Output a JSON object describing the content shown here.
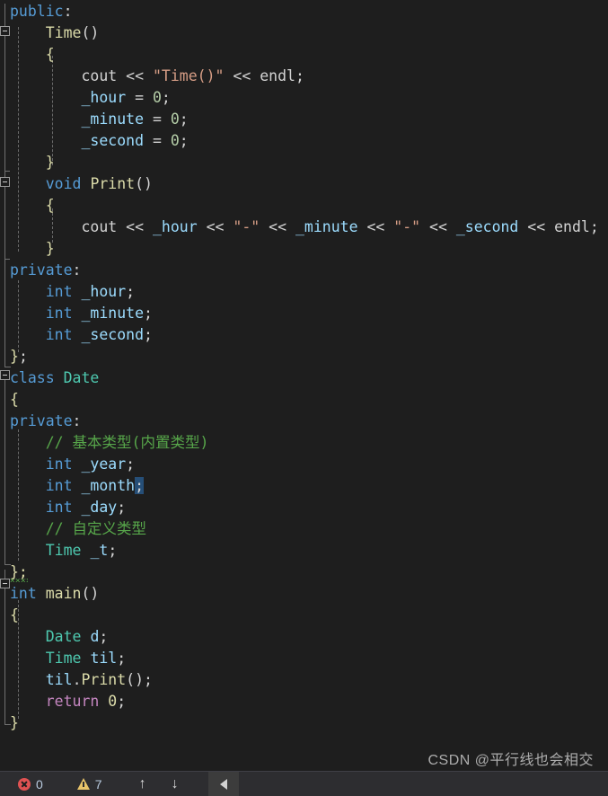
{
  "window": {
    "kind": "code-editor",
    "theme": "dark",
    "background": "#1e1e1e",
    "language": "C++"
  },
  "editor": {
    "lines": [
      {
        "n": 1,
        "indent": 0,
        "text": "public:"
      },
      {
        "n": 2,
        "indent": 1,
        "text": "Time()"
      },
      {
        "n": 3,
        "indent": 1,
        "text": "{"
      },
      {
        "n": 4,
        "indent": 2,
        "text": "cout << \"Time()\" << endl;"
      },
      {
        "n": 5,
        "indent": 2,
        "text": "_hour = 0;"
      },
      {
        "n": 6,
        "indent": 2,
        "text": "_minute = 0;"
      },
      {
        "n": 7,
        "indent": 2,
        "text": "_second = 0;"
      },
      {
        "n": 8,
        "indent": 1,
        "text": "}"
      },
      {
        "n": 9,
        "indent": 1,
        "text": "void Print()"
      },
      {
        "n": 10,
        "indent": 1,
        "text": "{"
      },
      {
        "n": 11,
        "indent": 2,
        "text": "cout << _hour << \"-\" << _minute << \"-\" << _second << endl;"
      },
      {
        "n": 12,
        "indent": 1,
        "text": "}"
      },
      {
        "n": 13,
        "indent": 0,
        "text": "private:"
      },
      {
        "n": 14,
        "indent": 1,
        "text": "int _hour;"
      },
      {
        "n": 15,
        "indent": 1,
        "text": "int _minute;"
      },
      {
        "n": 16,
        "indent": 1,
        "text": "int _second;"
      },
      {
        "n": 17,
        "indent": 0,
        "text": "};"
      },
      {
        "n": 18,
        "indent": 0,
        "text": "class Date"
      },
      {
        "n": 19,
        "indent": 0,
        "text": "{"
      },
      {
        "n": 20,
        "indent": 0,
        "text": "private:"
      },
      {
        "n": 21,
        "indent": 1,
        "text": "// 基本类型(内置类型)"
      },
      {
        "n": 22,
        "indent": 1,
        "text": "int _year;"
      },
      {
        "n": 23,
        "indent": 1,
        "text": "int _month;"
      },
      {
        "n": 24,
        "indent": 1,
        "text": "int _day;"
      },
      {
        "n": 25,
        "indent": 1,
        "text": "// 自定义类型"
      },
      {
        "n": 26,
        "indent": 1,
        "text": "Time _t;"
      },
      {
        "n": 27,
        "indent": 0,
        "text": "};"
      },
      {
        "n": 28,
        "indent": 0,
        "text": "int main()"
      },
      {
        "n": 29,
        "indent": 0,
        "text": "{"
      },
      {
        "n": 30,
        "indent": 1,
        "text": "Date d;"
      },
      {
        "n": 31,
        "indent": 1,
        "text": "Time til;"
      },
      {
        "n": 32,
        "indent": 1,
        "text": "til.Print();"
      },
      {
        "n": 33,
        "indent": 1,
        "text": "return 0;"
      },
      {
        "n": 34,
        "indent": 0,
        "text": "}"
      }
    ],
    "tokens": {
      "L1": [
        [
          "public",
          "t-kw"
        ],
        [
          ":",
          "t-punct"
        ]
      ],
      "L2": [
        [
          "    ",
          "t-plain"
        ],
        [
          "Time",
          "t-fn"
        ],
        [
          "()",
          "t-punct"
        ]
      ],
      "L3": [
        [
          "    ",
          "t-plain"
        ],
        [
          "{",
          "t-brace"
        ]
      ],
      "L4": [
        [
          "        ",
          "t-plain"
        ],
        [
          "cout",
          "t-cout"
        ],
        [
          " << ",
          "t-op"
        ],
        [
          "\"Time()\"",
          "t-str"
        ],
        [
          " << ",
          "t-op"
        ],
        [
          "endl",
          "t-cout"
        ],
        [
          ";",
          "t-punct"
        ]
      ],
      "L5": [
        [
          "        ",
          "t-plain"
        ],
        [
          "_hour",
          "t-var"
        ],
        [
          " = ",
          "t-op"
        ],
        [
          "0",
          "t-num"
        ],
        [
          ";",
          "t-punct"
        ]
      ],
      "L6": [
        [
          "        ",
          "t-plain"
        ],
        [
          "_minute",
          "t-var"
        ],
        [
          " = ",
          "t-op"
        ],
        [
          "0",
          "t-num"
        ],
        [
          ";",
          "t-punct"
        ]
      ],
      "L7": [
        [
          "        ",
          "t-plain"
        ],
        [
          "_second",
          "t-var"
        ],
        [
          " = ",
          "t-op"
        ],
        [
          "0",
          "t-num"
        ],
        [
          ";",
          "t-punct"
        ]
      ],
      "L8": [
        [
          "    ",
          "t-plain"
        ],
        [
          "}",
          "t-brace"
        ]
      ],
      "L9": [
        [
          "    ",
          "t-plain"
        ],
        [
          "void",
          "t-kw"
        ],
        [
          " ",
          "t-plain"
        ],
        [
          "Print",
          "t-fn"
        ],
        [
          "()",
          "t-punct"
        ]
      ],
      "L10": [
        [
          "    ",
          "t-plain"
        ],
        [
          "{",
          "t-brace"
        ]
      ],
      "L11": [
        [
          "        ",
          "t-plain"
        ],
        [
          "cout",
          "t-cout"
        ],
        [
          " << ",
          "t-op"
        ],
        [
          "_hour",
          "t-var"
        ],
        [
          " << ",
          "t-op"
        ],
        [
          "\"-\"",
          "t-str"
        ],
        [
          " << ",
          "t-op"
        ],
        [
          "_minute",
          "t-var"
        ],
        [
          " << ",
          "t-op"
        ],
        [
          "\"-\"",
          "t-str"
        ],
        [
          " << ",
          "t-op"
        ],
        [
          "_second",
          "t-var"
        ],
        [
          " << ",
          "t-op"
        ],
        [
          "endl",
          "t-cout"
        ],
        [
          ";",
          "t-punct"
        ]
      ],
      "L12": [
        [
          "    ",
          "t-plain"
        ],
        [
          "}",
          "t-brace"
        ]
      ],
      "L13": [
        [
          "private",
          "t-kw"
        ],
        [
          ":",
          "t-punct"
        ]
      ],
      "L14": [
        [
          "    ",
          "t-plain"
        ],
        [
          "int",
          "t-kw"
        ],
        [
          " ",
          "t-plain"
        ],
        [
          "_hour",
          "t-var"
        ],
        [
          ";",
          "t-punct"
        ]
      ],
      "L15": [
        [
          "    ",
          "t-plain"
        ],
        [
          "int",
          "t-kw"
        ],
        [
          " ",
          "t-plain"
        ],
        [
          "_minute",
          "t-var"
        ],
        [
          ";",
          "t-punct"
        ]
      ],
      "L16": [
        [
          "    ",
          "t-plain"
        ],
        [
          "int",
          "t-kw"
        ],
        [
          " ",
          "t-plain"
        ],
        [
          "_second",
          "t-var"
        ],
        [
          ";",
          "t-punct"
        ]
      ],
      "L17": [
        [
          "}",
          "t-brace"
        ],
        [
          ";",
          "t-punct"
        ]
      ],
      "L18": [
        [
          "class",
          "t-kw"
        ],
        [
          " ",
          "t-plain"
        ],
        [
          "Date",
          "t-type"
        ]
      ],
      "L19": [
        [
          "{",
          "t-brace"
        ]
      ],
      "L20": [
        [
          "private",
          "t-kw"
        ],
        [
          ":",
          "t-punct"
        ]
      ],
      "L21": [
        [
          "    ",
          "t-plain"
        ],
        [
          "// 基本类型(内置类型)",
          "t-cmt"
        ]
      ],
      "L22": [
        [
          "    ",
          "t-plain"
        ],
        [
          "int",
          "t-kw"
        ],
        [
          " ",
          "t-plain"
        ],
        [
          "_year",
          "t-var"
        ],
        [
          ";",
          "t-punct"
        ]
      ],
      "L23": [
        [
          "    ",
          "t-plain"
        ],
        [
          "int",
          "t-kw"
        ],
        [
          " ",
          "t-plain"
        ],
        [
          "_month",
          "t-var"
        ],
        [
          ";",
          "t-punct sel"
        ]
      ],
      "L24": [
        [
          "    ",
          "t-plain"
        ],
        [
          "int",
          "t-kw"
        ],
        [
          " ",
          "t-plain"
        ],
        [
          "_day",
          "t-var"
        ],
        [
          ";",
          "t-punct"
        ]
      ],
      "L25": [
        [
          "    ",
          "t-plain"
        ],
        [
          "// 自定义类型",
          "t-cmt"
        ]
      ],
      "L26": [
        [
          "    ",
          "t-plain"
        ],
        [
          "Time",
          "t-type"
        ],
        [
          " ",
          "t-plain"
        ],
        [
          "_t",
          "t-var"
        ],
        [
          ";",
          "t-punct"
        ]
      ],
      "L27": [
        [
          "};",
          "t-brace squiggle"
        ]
      ],
      "L28": [
        [
          "int",
          "t-kw"
        ],
        [
          " ",
          "t-plain"
        ],
        [
          "main",
          "t-fn"
        ],
        [
          "()",
          "t-punct"
        ]
      ],
      "L29": [
        [
          "{",
          "t-brace"
        ]
      ],
      "L30": [
        [
          "    ",
          "t-plain"
        ],
        [
          "Date",
          "t-type"
        ],
        [
          " ",
          "t-plain"
        ],
        [
          "d",
          "t-var"
        ],
        [
          ";",
          "t-punct"
        ]
      ],
      "L31": [
        [
          "    ",
          "t-plain"
        ],
        [
          "Time",
          "t-type"
        ],
        [
          " ",
          "t-plain"
        ],
        [
          "til",
          "t-var"
        ],
        [
          ";",
          "t-punct"
        ]
      ],
      "L32": [
        [
          "    ",
          "t-plain"
        ],
        [
          "til",
          "t-var"
        ],
        [
          ".",
          "t-punct"
        ],
        [
          "Print",
          "t-fn"
        ],
        [
          "()",
          "t-punct"
        ],
        [
          ";",
          "t-punct"
        ]
      ],
      "L33": [
        [
          "    ",
          "t-plain"
        ],
        [
          "return",
          "t-ctrl"
        ],
        [
          " ",
          "t-plain"
        ],
        [
          "0",
          "t-numlit"
        ],
        [
          ";",
          "t-punct"
        ]
      ],
      "L34": [
        [
          "}",
          "t-brace"
        ]
      ]
    },
    "selection": {
      "line": 23,
      "text": ";",
      "color": "#264f78"
    },
    "diagnostic_squiggle": {
      "line": 27,
      "text": "};",
      "color": "#57a64a"
    },
    "fold_markers": [
      {
        "line": 2,
        "state": "expanded"
      },
      {
        "line": 9,
        "state": "expanded"
      },
      {
        "line": 18,
        "state": "expanded"
      },
      {
        "line": 28,
        "state": "expanded"
      }
    ]
  },
  "status_bar": {
    "errors": {
      "icon": "error-circle-x-icon",
      "count": "0",
      "color": "#e05252"
    },
    "warnings": {
      "icon": "warning-triangle-icon",
      "count": "7",
      "color": "#e8c46a"
    },
    "prev_button": {
      "icon": "arrow-up-icon",
      "glyph": "↑"
    },
    "next_button": {
      "icon": "arrow-down-icon",
      "glyph": "↓"
    },
    "collapse_button": {
      "icon": "triangle-left-icon"
    }
  },
  "watermark": {
    "text": "CSDN @平行线也会相交"
  }
}
